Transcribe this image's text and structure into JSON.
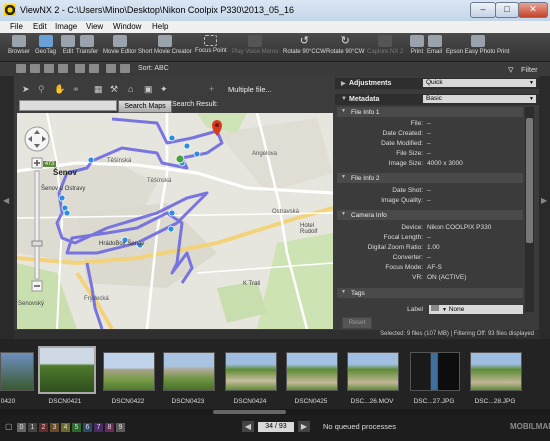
{
  "window": {
    "title": "ViewNX 2 - C:\\Users\\Mino\\Desktop\\Nikon Coolpix P330\\2013_05_16",
    "minimize": "–",
    "maximize": "□",
    "close": "✕"
  },
  "menu": [
    "File",
    "Edit",
    "Image",
    "View",
    "Window",
    "Help"
  ],
  "toolbar": {
    "items": [
      "Browser",
      "GeoTag",
      "Edit",
      "Transfer",
      "Movie Editor",
      "Short Movie Creator",
      "Focus Point",
      "Play Voice Memo",
      "Rotate 90°CCW",
      "Rotate 90°CW",
      "Capture NX 2",
      "Print",
      "Email",
      "Epson Easy Photo Print"
    ],
    "filter_label": "Filter"
  },
  "subbar": {
    "sort_label": "Sort: ABC"
  },
  "map": {
    "multiple_file_label": "Multiple file...",
    "search_placeholder": "",
    "search_button": "Search Maps",
    "search_result_label": "Search Result:",
    "road_number": "473",
    "places": [
      "Šenov",
      "Šenov u Ostravy",
      "Těšínská",
      "Těšínská",
      "Ostravská",
      "Hotel Rudolf",
      "Frýdecká",
      "Angelova",
      "K Trati",
      "HrádoBox Šenov",
      "Senovský",
      "Frýdecká"
    ],
    "route_color": "#6b68e0",
    "pin_color": "#2f8de0",
    "accent_pin": "#d63a1f",
    "current_pin": "#46a33a"
  },
  "panel": {
    "adjustments_label": "Adjustments",
    "adjustments_value": "Quick",
    "metadata_label": "Metadata",
    "metadata_value": "Basic",
    "file_info_1": {
      "title": "File Info 1",
      "rows": [
        {
          "k": "File:",
          "v": "–"
        },
        {
          "k": "Date Created:",
          "v": "–"
        },
        {
          "k": "Date Modified:",
          "v": "–"
        },
        {
          "k": "File Size:",
          "v": "–"
        },
        {
          "k": "Image Size:",
          "v": "4000 x 3000"
        }
      ]
    },
    "file_info_2": {
      "title": "File Info 2",
      "rows": [
        {
          "k": "Date Shot:",
          "v": "–"
        },
        {
          "k": "Image Quality:",
          "v": "–"
        }
      ]
    },
    "camera_info": {
      "title": "Camera Info",
      "rows": [
        {
          "k": "Device:",
          "v": "Nikon COOLPIX P330"
        },
        {
          "k": "Focal Length:",
          "v": "–"
        },
        {
          "k": "Digital Zoom Ratio:",
          "v": "1.00"
        },
        {
          "k": "Converter:",
          "v": "–"
        },
        {
          "k": "Focus Mode:",
          "v": "AF-S"
        },
        {
          "k": "VR:",
          "v": "ON (ACTIVE)"
        }
      ]
    },
    "tags": {
      "title": "Tags",
      "label_key": "Label",
      "label_value": "None"
    },
    "reset": "Reset"
  },
  "status": "Selected: 9 files (107 MB) | Filtering Off: 93 files displayed",
  "filmstrip": {
    "labels": [
      "0420",
      "DSCN0421",
      "DSCN0422",
      "DSCN0423",
      "DSCN0424",
      "DSCN0425",
      "DSC...26.MOV",
      "DSC...27.JPG",
      "DSC...28.JPG"
    ]
  },
  "bottom": {
    "numbers": [
      "0",
      "1",
      "2",
      "3",
      "4",
      "5",
      "6",
      "7",
      "8",
      "9"
    ],
    "page": "34 / 93",
    "queue": "No queued processes",
    "logo": "MOBILMANIA"
  }
}
